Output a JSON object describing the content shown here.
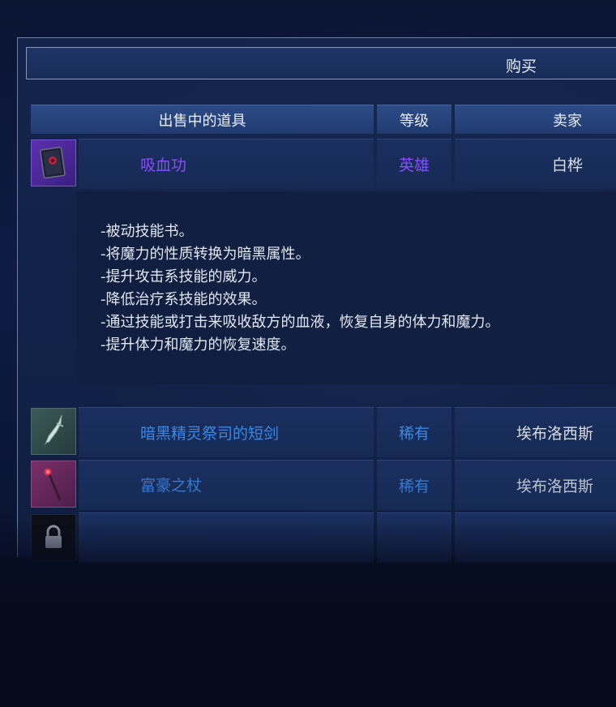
{
  "buy_label": "购买",
  "headers": {
    "item": "出售中的道具",
    "grade": "等级",
    "seller": "卖家"
  },
  "colors": {
    "heroic": "#8a4bff",
    "rare": "#3b88e8",
    "seller_text": "#d7dbe4"
  },
  "selected_item": {
    "name": "吸血功",
    "grade": "英雄",
    "seller": "白桦",
    "icon": "skill-book-icon",
    "description": [
      "-被动技能书。",
      "-将魔力的性质转换为暗黑属性。",
      "-提升攻击系技能的威力。",
      "-降低治疗系技能的效果。",
      "-通过技能或打击来吸收敌方的血液，恢复自身的体力和魔力。",
      "-提升体力和魔力的恢复速度。"
    ]
  },
  "items": [
    {
      "name": "暗黑精灵祭司的短剑",
      "grade": "稀有",
      "seller": "埃布洛西斯",
      "icon": "dagger-icon"
    },
    {
      "name": "富豪之杖",
      "grade": "稀有",
      "seller": "埃布洛西斯",
      "icon": "staff-icon"
    }
  ],
  "locked_slot_icon": "lock-icon"
}
